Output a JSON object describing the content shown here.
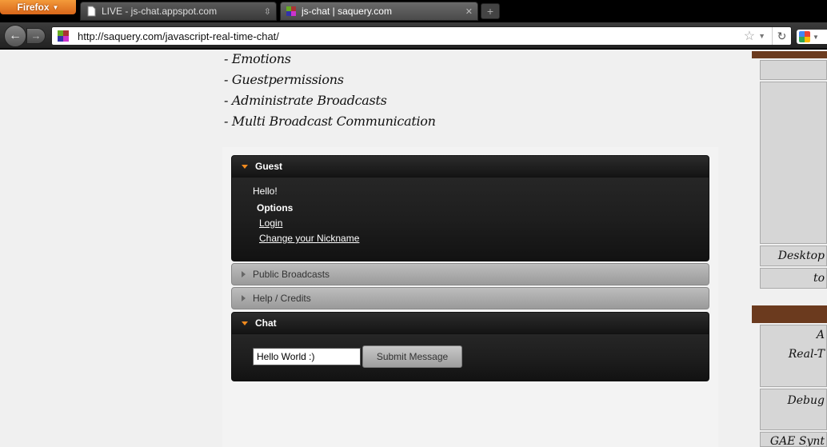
{
  "browser": {
    "menu_label": "Firefox",
    "tabs": [
      {
        "title": "LIVE - js-chat.appspot.com",
        "active": false
      },
      {
        "title": "js-chat | saquery.com",
        "active": true
      }
    ],
    "url": "http://saquery.com/javascript-real-time-chat/"
  },
  "features": [
    "- Emotions",
    "- Guestpermissions",
    "- Administrate Broadcasts",
    "- Multi Broadcast Communication"
  ],
  "guest_panel": {
    "title": "Guest",
    "greeting": "Hello!",
    "options_label": "Options",
    "links": [
      "Login",
      "Change your Nickname"
    ]
  },
  "collapsed_panels": [
    "Public Broadcasts",
    "Help / Credits"
  ],
  "chat_panel": {
    "title": "Chat",
    "input_value": "Hello World :)",
    "submit_label": "Submit Message"
  },
  "sidebar": {
    "items": [
      "Desktop",
      "to",
      "A",
      "Real-T",
      "Debug",
      "GAE Synt"
    ]
  },
  "colors": {
    "accent_orange": "#f08a1e",
    "sidebar_brown": "#6b3a1e",
    "panel_dark": "#1e1e1e"
  }
}
